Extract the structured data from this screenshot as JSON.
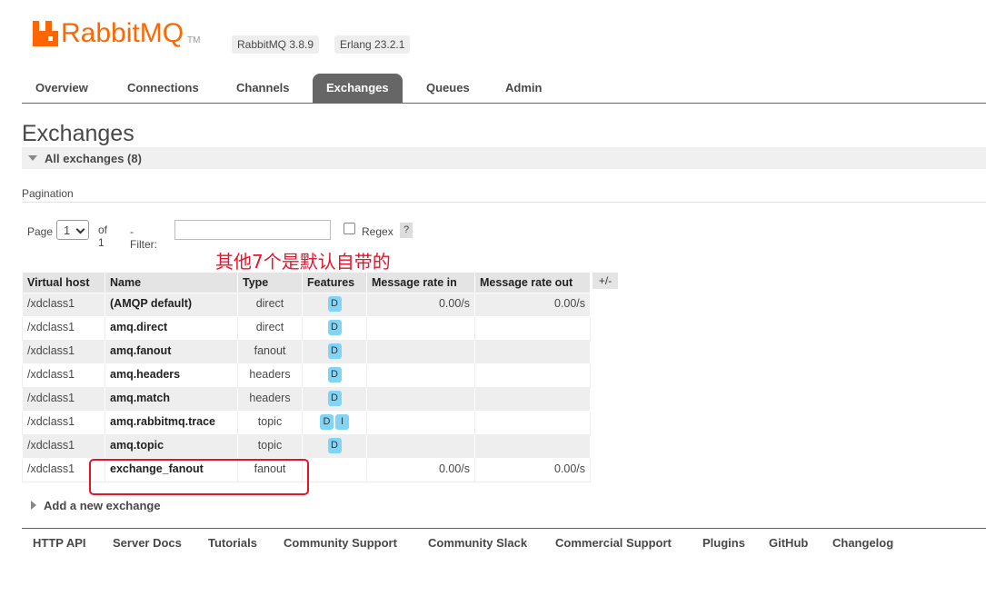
{
  "header": {
    "logo_text": "RabbitMQ",
    "logo_tm": "TM",
    "version": "RabbitMQ 3.8.9",
    "erlang": "Erlang 23.2.1"
  },
  "tabs": [
    "Overview",
    "Connections",
    "Channels",
    "Exchanges",
    "Queues",
    "Admin"
  ],
  "active_tab": "Exchanges",
  "page_title": "Exchanges",
  "section": {
    "label": "All exchanges (8)"
  },
  "pagination": {
    "label": "Pagination",
    "page_label": "Page",
    "page_value": "1",
    "of_label": "of 1",
    "filter_label": "- Filter:",
    "filter_value": "",
    "regex_label": "Regex",
    "help_label": "?"
  },
  "annotation": "其他7个是默认自带的",
  "table": {
    "headers": [
      "Virtual host",
      "Name",
      "Type",
      "Features",
      "Message rate in",
      "Message rate out"
    ],
    "toggle_label": "+/-",
    "rows": [
      {
        "vhost": "/xdclass1",
        "name": "(AMQP default)",
        "type": "direct",
        "features": [
          "D"
        ],
        "rate_in": "0.00/s",
        "rate_out": "0.00/s"
      },
      {
        "vhost": "/xdclass1",
        "name": "amq.direct",
        "type": "direct",
        "features": [
          "D"
        ],
        "rate_in": "",
        "rate_out": ""
      },
      {
        "vhost": "/xdclass1",
        "name": "amq.fanout",
        "type": "fanout",
        "features": [
          "D"
        ],
        "rate_in": "",
        "rate_out": ""
      },
      {
        "vhost": "/xdclass1",
        "name": "amq.headers",
        "type": "headers",
        "features": [
          "D"
        ],
        "rate_in": "",
        "rate_out": ""
      },
      {
        "vhost": "/xdclass1",
        "name": "amq.match",
        "type": "headers",
        "features": [
          "D"
        ],
        "rate_in": "",
        "rate_out": ""
      },
      {
        "vhost": "/xdclass1",
        "name": "amq.rabbitmq.trace",
        "type": "topic",
        "features": [
          "D",
          "I"
        ],
        "rate_in": "",
        "rate_out": ""
      },
      {
        "vhost": "/xdclass1",
        "name": "amq.topic",
        "type": "topic",
        "features": [
          "D"
        ],
        "rate_in": "",
        "rate_out": ""
      },
      {
        "vhost": "/xdclass1",
        "name": "exchange_fanout",
        "type": "fanout",
        "features": [],
        "rate_in": "0.00/s",
        "rate_out": "0.00/s"
      }
    ]
  },
  "add_new_label": "Add a new exchange",
  "footer_links": [
    "HTTP API",
    "Server Docs",
    "Tutorials",
    "Community Support",
    "Community Slack",
    "Commercial Support",
    "Plugins",
    "GitHub",
    "Changelog"
  ],
  "colors": {
    "brand": "#ff6600",
    "annotation": "#e8132a",
    "badge": "#80d4f5",
    "active_tab": "#666666"
  }
}
